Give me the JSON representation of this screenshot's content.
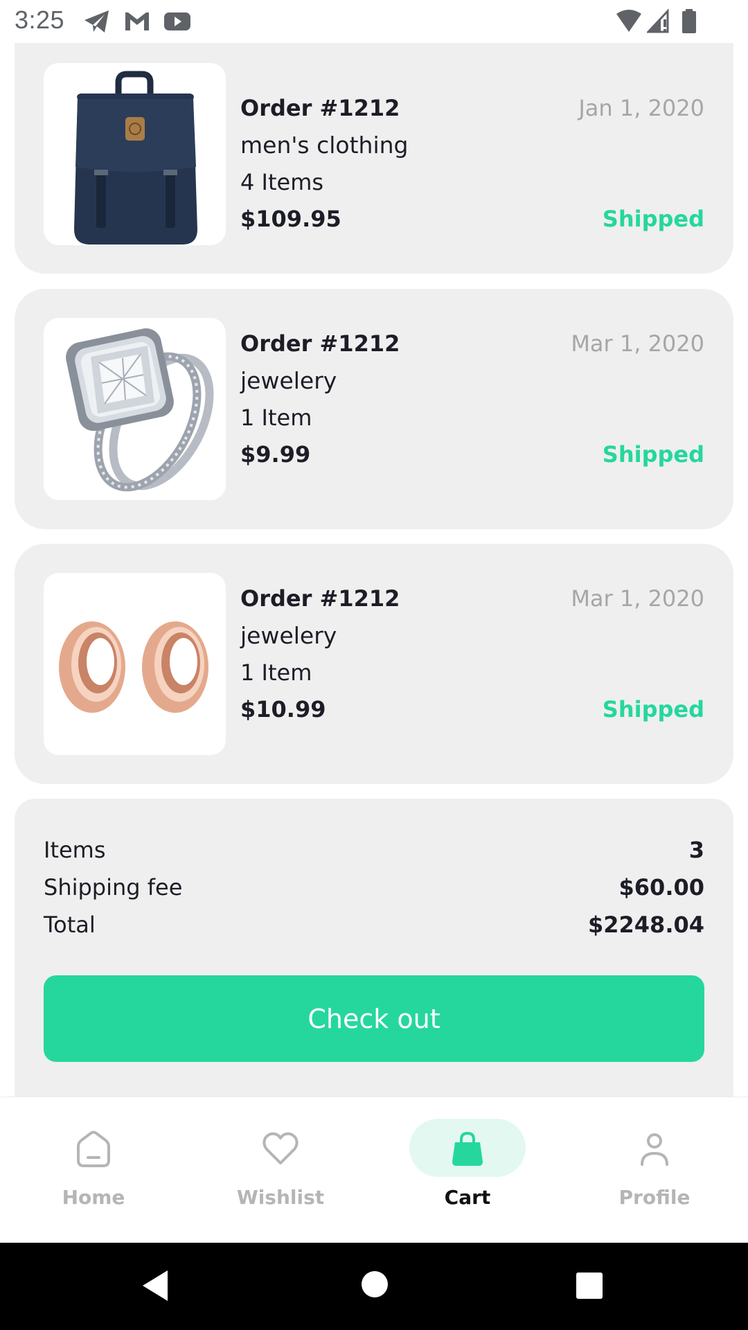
{
  "status_bar": {
    "time": "3:25",
    "left_icons": [
      "telegram-icon",
      "gmail-icon",
      "youtube-icon"
    ],
    "right_icons": [
      "wifi-icon",
      "cell-signal-icon",
      "battery-icon"
    ]
  },
  "orders": [
    {
      "title": "Order #1212",
      "date": "Jan 1, 2020",
      "category": "men's clothing",
      "items": "4 Items",
      "price": "$109.95",
      "status": "Shipped",
      "image": "backpack"
    },
    {
      "title": "Order #1212",
      "date": "Mar 1, 2020",
      "category": "jewelery",
      "items": "1 Item",
      "price": "$9.99",
      "status": "Shipped",
      "image": "diamond-ring"
    },
    {
      "title": "Order #1212",
      "date": "Mar 1, 2020",
      "category": "jewelery",
      "items": "1 Item",
      "price": "$10.99",
      "status": "Shipped",
      "image": "rose-gold-plugs"
    }
  ],
  "summary": {
    "items_label": "Items",
    "items_value": "3",
    "shipping_label": "Shipping fee",
    "shipping_value": "$60.00",
    "total_label": "Total",
    "total_value": "$2248.04",
    "checkout_label": "Check out"
  },
  "bottom_nav": {
    "items": [
      {
        "label": "Home",
        "icon": "home-icon",
        "active": false
      },
      {
        "label": "Wishlist",
        "icon": "heart-icon",
        "active": false
      },
      {
        "label": "Cart",
        "icon": "shopping-bag-icon",
        "active": true
      },
      {
        "label": "Profile",
        "icon": "person-icon",
        "active": false
      }
    ]
  },
  "system_nav": [
    "back-icon",
    "home-circle-icon",
    "recents-icon"
  ],
  "colors": {
    "accent": "#25d79d",
    "accent_light": "#e3f8f1",
    "card_bg": "#efefef",
    "text_primary": "#1d1d27",
    "text_muted": "#a6a6a6",
    "nav_inactive": "#b5b5b5"
  }
}
